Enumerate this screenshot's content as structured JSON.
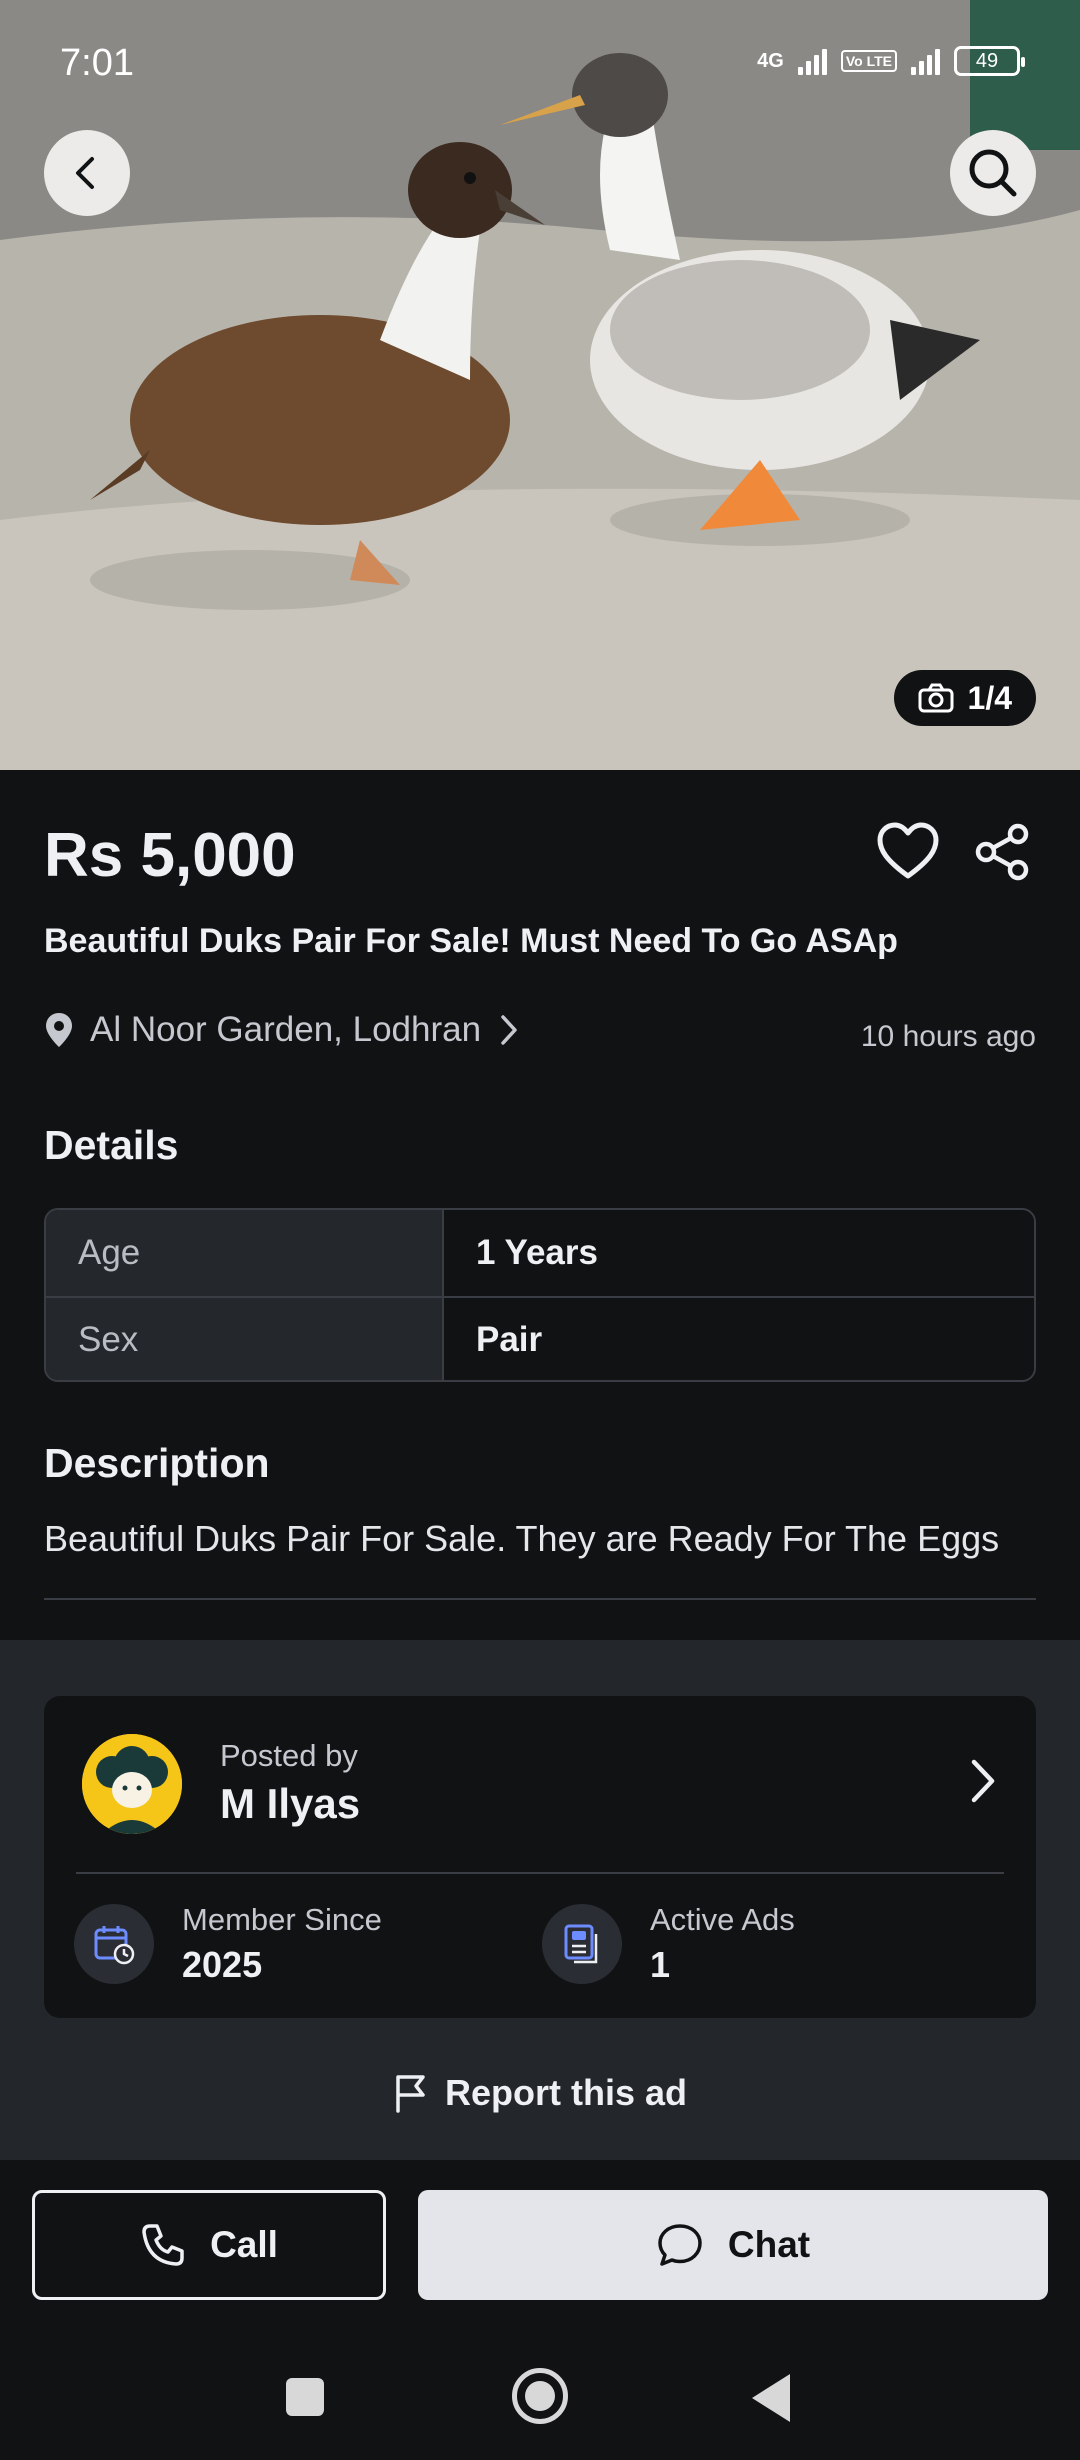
{
  "status_bar": {
    "time": "7:01",
    "network_label": "4G",
    "volte_label": "Vo LTE",
    "battery": "49"
  },
  "hero": {
    "image_subject": "two ducks on concrete floor",
    "photo_counter": "1/4"
  },
  "listing": {
    "price": "Rs 5,000",
    "title": "Beautiful Duks Pair For Sale! Must Need To Go ASAp",
    "location": "Al Noor Garden, Lodhran",
    "posted_ago": "10 hours ago"
  },
  "details": {
    "heading": "Details",
    "rows": [
      {
        "key": "Age",
        "value": "1 Years"
      },
      {
        "key": "Sex",
        "value": "Pair"
      }
    ]
  },
  "description": {
    "heading": "Description",
    "text": "Beautiful Duks Pair For Sale. They are Ready For The Eggs"
  },
  "seller": {
    "posted_by_label": "Posted by",
    "name": "M Ilyas",
    "member_since_label": "Member Since",
    "member_since_value": "2025",
    "active_ads_label": "Active Ads",
    "active_ads_value": "1"
  },
  "report": {
    "label": "Report this ad"
  },
  "actions": {
    "call_label": "Call",
    "chat_label": "Chat"
  },
  "icons": {
    "back": "chevron-left-icon",
    "search": "search-icon",
    "camera": "camera-icon",
    "favorite": "heart-icon",
    "share": "share-icon",
    "location": "location-pin-icon",
    "calendar": "calendar-clock-icon",
    "ads": "ad-document-icon",
    "flag": "flag-icon",
    "phone": "phone-icon",
    "chat": "chat-bubble-icon"
  },
  "colors": {
    "background": "#111214",
    "surface": "#23262b",
    "text_primary": "#eef0f3",
    "text_secondary": "#c5c8cf",
    "chat_button": "#e3e5ea",
    "avatar_bg": "#f5c518",
    "icon_accent": "#6c8cff"
  }
}
